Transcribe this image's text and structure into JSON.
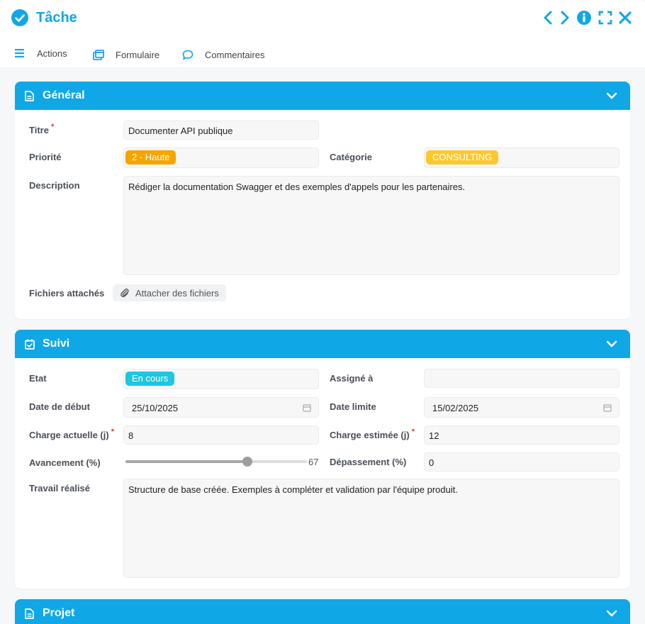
{
  "window": {
    "title": "Tâche",
    "controls": [
      "previous-icon",
      "next-icon",
      "info-icon",
      "expand-icon",
      "close-icon"
    ]
  },
  "nav": {
    "actions": "Actions",
    "formulaire": "Formulaire",
    "commentaires": "Commentaires"
  },
  "general": {
    "header": "Général",
    "titre_label": "Titre",
    "titre_value": "Documenter API publique",
    "priorite_label": "Priorité",
    "priorite_value": "2 - Haute",
    "priorite_color": "#f5a400",
    "categorie_label": "Catégorie",
    "categorie_value": "CONSULTING",
    "categorie_color": "#fdc82f",
    "description_label": "Description",
    "description_value": "Rédiger la documentation Swagger et des exemples d'appels pour les partenaires.",
    "fichiers_label": "Fichiers attachés",
    "attach_button": "Attacher des fichiers"
  },
  "suivi": {
    "header": "Suivi",
    "etat_label": "Etat",
    "etat_value": "En cours",
    "etat_color": "#1ec6e0",
    "assigne_label": "Assigné à",
    "assigne_value": "",
    "date_debut_label": "Date de début",
    "date_debut_value": "25/10/2025",
    "date_limite_label": "Date limite",
    "date_limite_value": "15/02/2025",
    "charge_actuelle_label": "Charge actuelle (j)",
    "charge_actuelle_value": "8",
    "charge_estimee_label": "Charge estimée (j)",
    "charge_estimee_value": "12",
    "avancement_label": "Avancement (%)",
    "avancement_value": "67",
    "avancement_fraction": 0.67,
    "depassement_label": "Dépassement (%)",
    "depassement_value": "0",
    "travail_label": "Travail réalisé",
    "travail_value": "Structure de base créée. Exemples à compléter et validation par l'équipe produit."
  },
  "projet": {
    "header": "Projet"
  },
  "colors": {
    "accent": "#10a7e7",
    "required": "#e53935"
  }
}
